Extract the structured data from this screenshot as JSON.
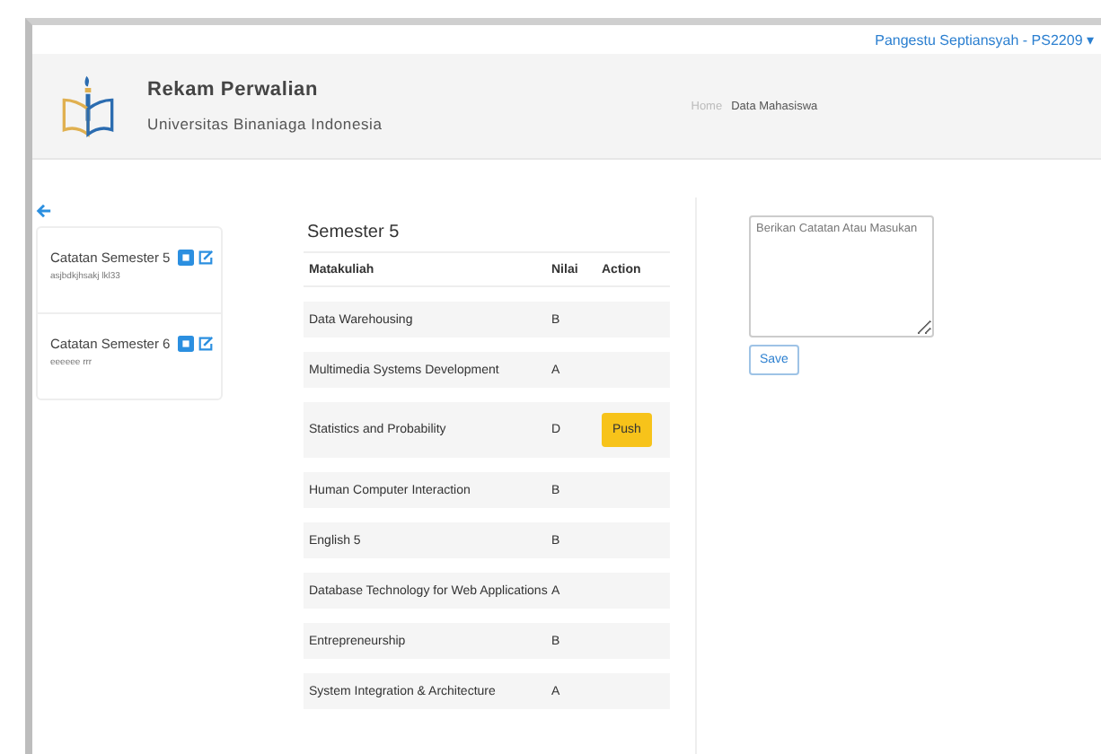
{
  "user_menu": {
    "label": "Pangestu Septiansyah - PS2209",
    "caret": "▾"
  },
  "header": {
    "title": "Rekam Perwalian",
    "subtitle": "Universitas Binaniaga Indonesia"
  },
  "breadcrumb": [
    {
      "label": "Home",
      "selected": false
    },
    {
      "label": "Data Mahasiswa",
      "selected": true
    }
  ],
  "notes": [
    {
      "title": "Catatan Semester 5",
      "text": "asjbdkjhsakj lkl33"
    },
    {
      "title": "Catatan Semester 6",
      "text": "eeeeee rrr"
    }
  ],
  "semester": {
    "title": "Semester 5",
    "columns": [
      "Matakuliah",
      "Nilai",
      "Action"
    ],
    "rows": [
      {
        "course": "Data Warehousing",
        "grade": "B"
      },
      {
        "course": "Multimedia Systems Development",
        "grade": "A"
      },
      {
        "course": "Statistics and Probability",
        "grade": "D",
        "action": "Push"
      },
      {
        "course": "Human Computer Interaction",
        "grade": "B"
      },
      {
        "course": "English 5",
        "grade": "B"
      },
      {
        "course": "Database Technology for Web Applications",
        "grade": "A"
      },
      {
        "course": "Entrepreneurship",
        "grade": "B"
      },
      {
        "course": "System Integration & Architecture",
        "grade": "A"
      }
    ]
  },
  "comment": {
    "placeholder": "Berikan Catatan Atau Masukan",
    "button": "Save"
  }
}
